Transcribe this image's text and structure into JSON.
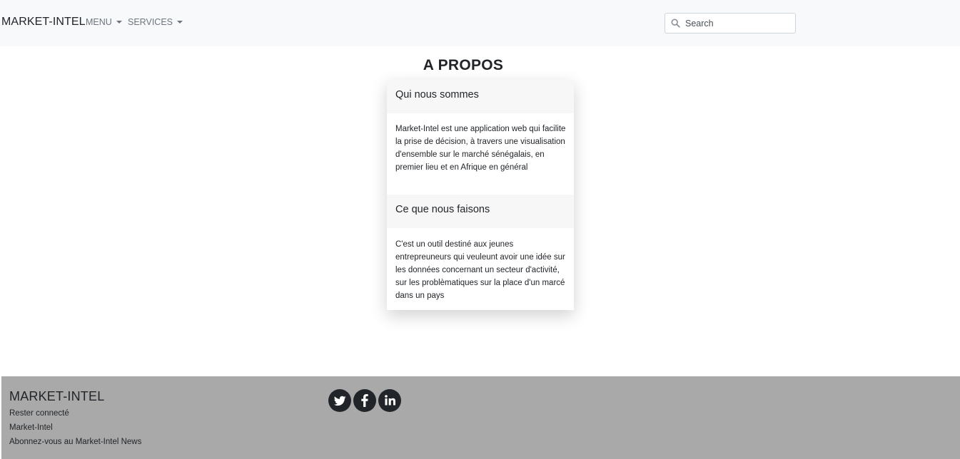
{
  "navbar": {
    "brand": "MARKET-INTEL",
    "menu_label": "MENU",
    "services_label": "SERVICES",
    "search_placeholder": "Search",
    "search_icon": "search-icon"
  },
  "main": {
    "title": "A PROPOS",
    "sections": [
      {
        "header": "Qui nous sommes",
        "text": "Market-Intel est une application web qui facilite la prise de décision, à travers une visualisation d'ensemble sur le marché sénégalais, en premier lieu et en Afrique en général"
      },
      {
        "header": "Ce que nous faisons",
        "text": "C'est un outil destiné aux jeunes entrepreuneurs qui veuleunt avoir une idée sur les données concernant un secteur d'activité, sur les problèmatiques sur la place d'un marcé dans un pays"
      }
    ]
  },
  "footer": {
    "brand": "MARKET-INTEL",
    "links": [
      "Rester connecté",
      "Market-Intel",
      "Abonnez-vous au Market-Intel News"
    ],
    "social": [
      "twitter-icon",
      "facebook-icon",
      "linkedin-icon"
    ]
  },
  "colors": {
    "navbar_bg": "#f8f9fa",
    "footer_bg": "#a9a9a9",
    "text": "#212529",
    "nav_link": "#6c757d",
    "social_bg": "#212529"
  }
}
